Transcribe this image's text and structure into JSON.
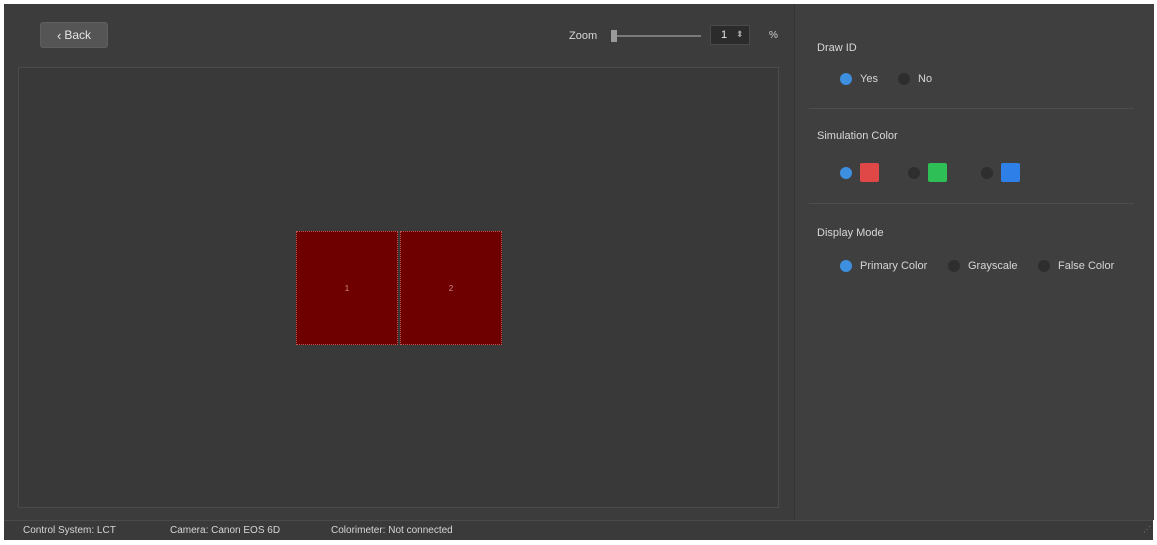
{
  "toolbar": {
    "back_label": "Back",
    "back_icon": "chevron-left-icon",
    "zoom_label": "Zoom",
    "zoom_value": "1",
    "zoom_unit": "%",
    "zoom_slider_level": 0
  },
  "canvas": {
    "cabinets": [
      {
        "id": "1",
        "color": "#6e0000"
      },
      {
        "id": "2",
        "color": "#6e0000"
      }
    ]
  },
  "panel": {
    "draw_id": {
      "title": "Draw ID",
      "options": [
        {
          "label": "Yes",
          "selected": true
        },
        {
          "label": "No",
          "selected": false
        }
      ]
    },
    "simulation_color": {
      "title": "Simulation Color",
      "options": [
        {
          "color": "#e04848",
          "selected": true
        },
        {
          "color": "#2fbf57",
          "selected": false
        },
        {
          "color": "#2f7fe8",
          "selected": false
        }
      ]
    },
    "display_mode": {
      "title": "Display Mode",
      "options": [
        {
          "label": "Primary Color",
          "selected": true
        },
        {
          "label": "Grayscale",
          "selected": false
        },
        {
          "label": "False Color",
          "selected": false
        }
      ]
    }
  },
  "status": {
    "control_system": "Control System:  LCT",
    "camera": "Camera:  Canon EOS 6D",
    "colorimeter": "Colorimeter:  Not connected"
  },
  "colors": {
    "accent": "#3d8fe0",
    "background": "#3c3c3c",
    "cabinet": "#6e0000"
  }
}
